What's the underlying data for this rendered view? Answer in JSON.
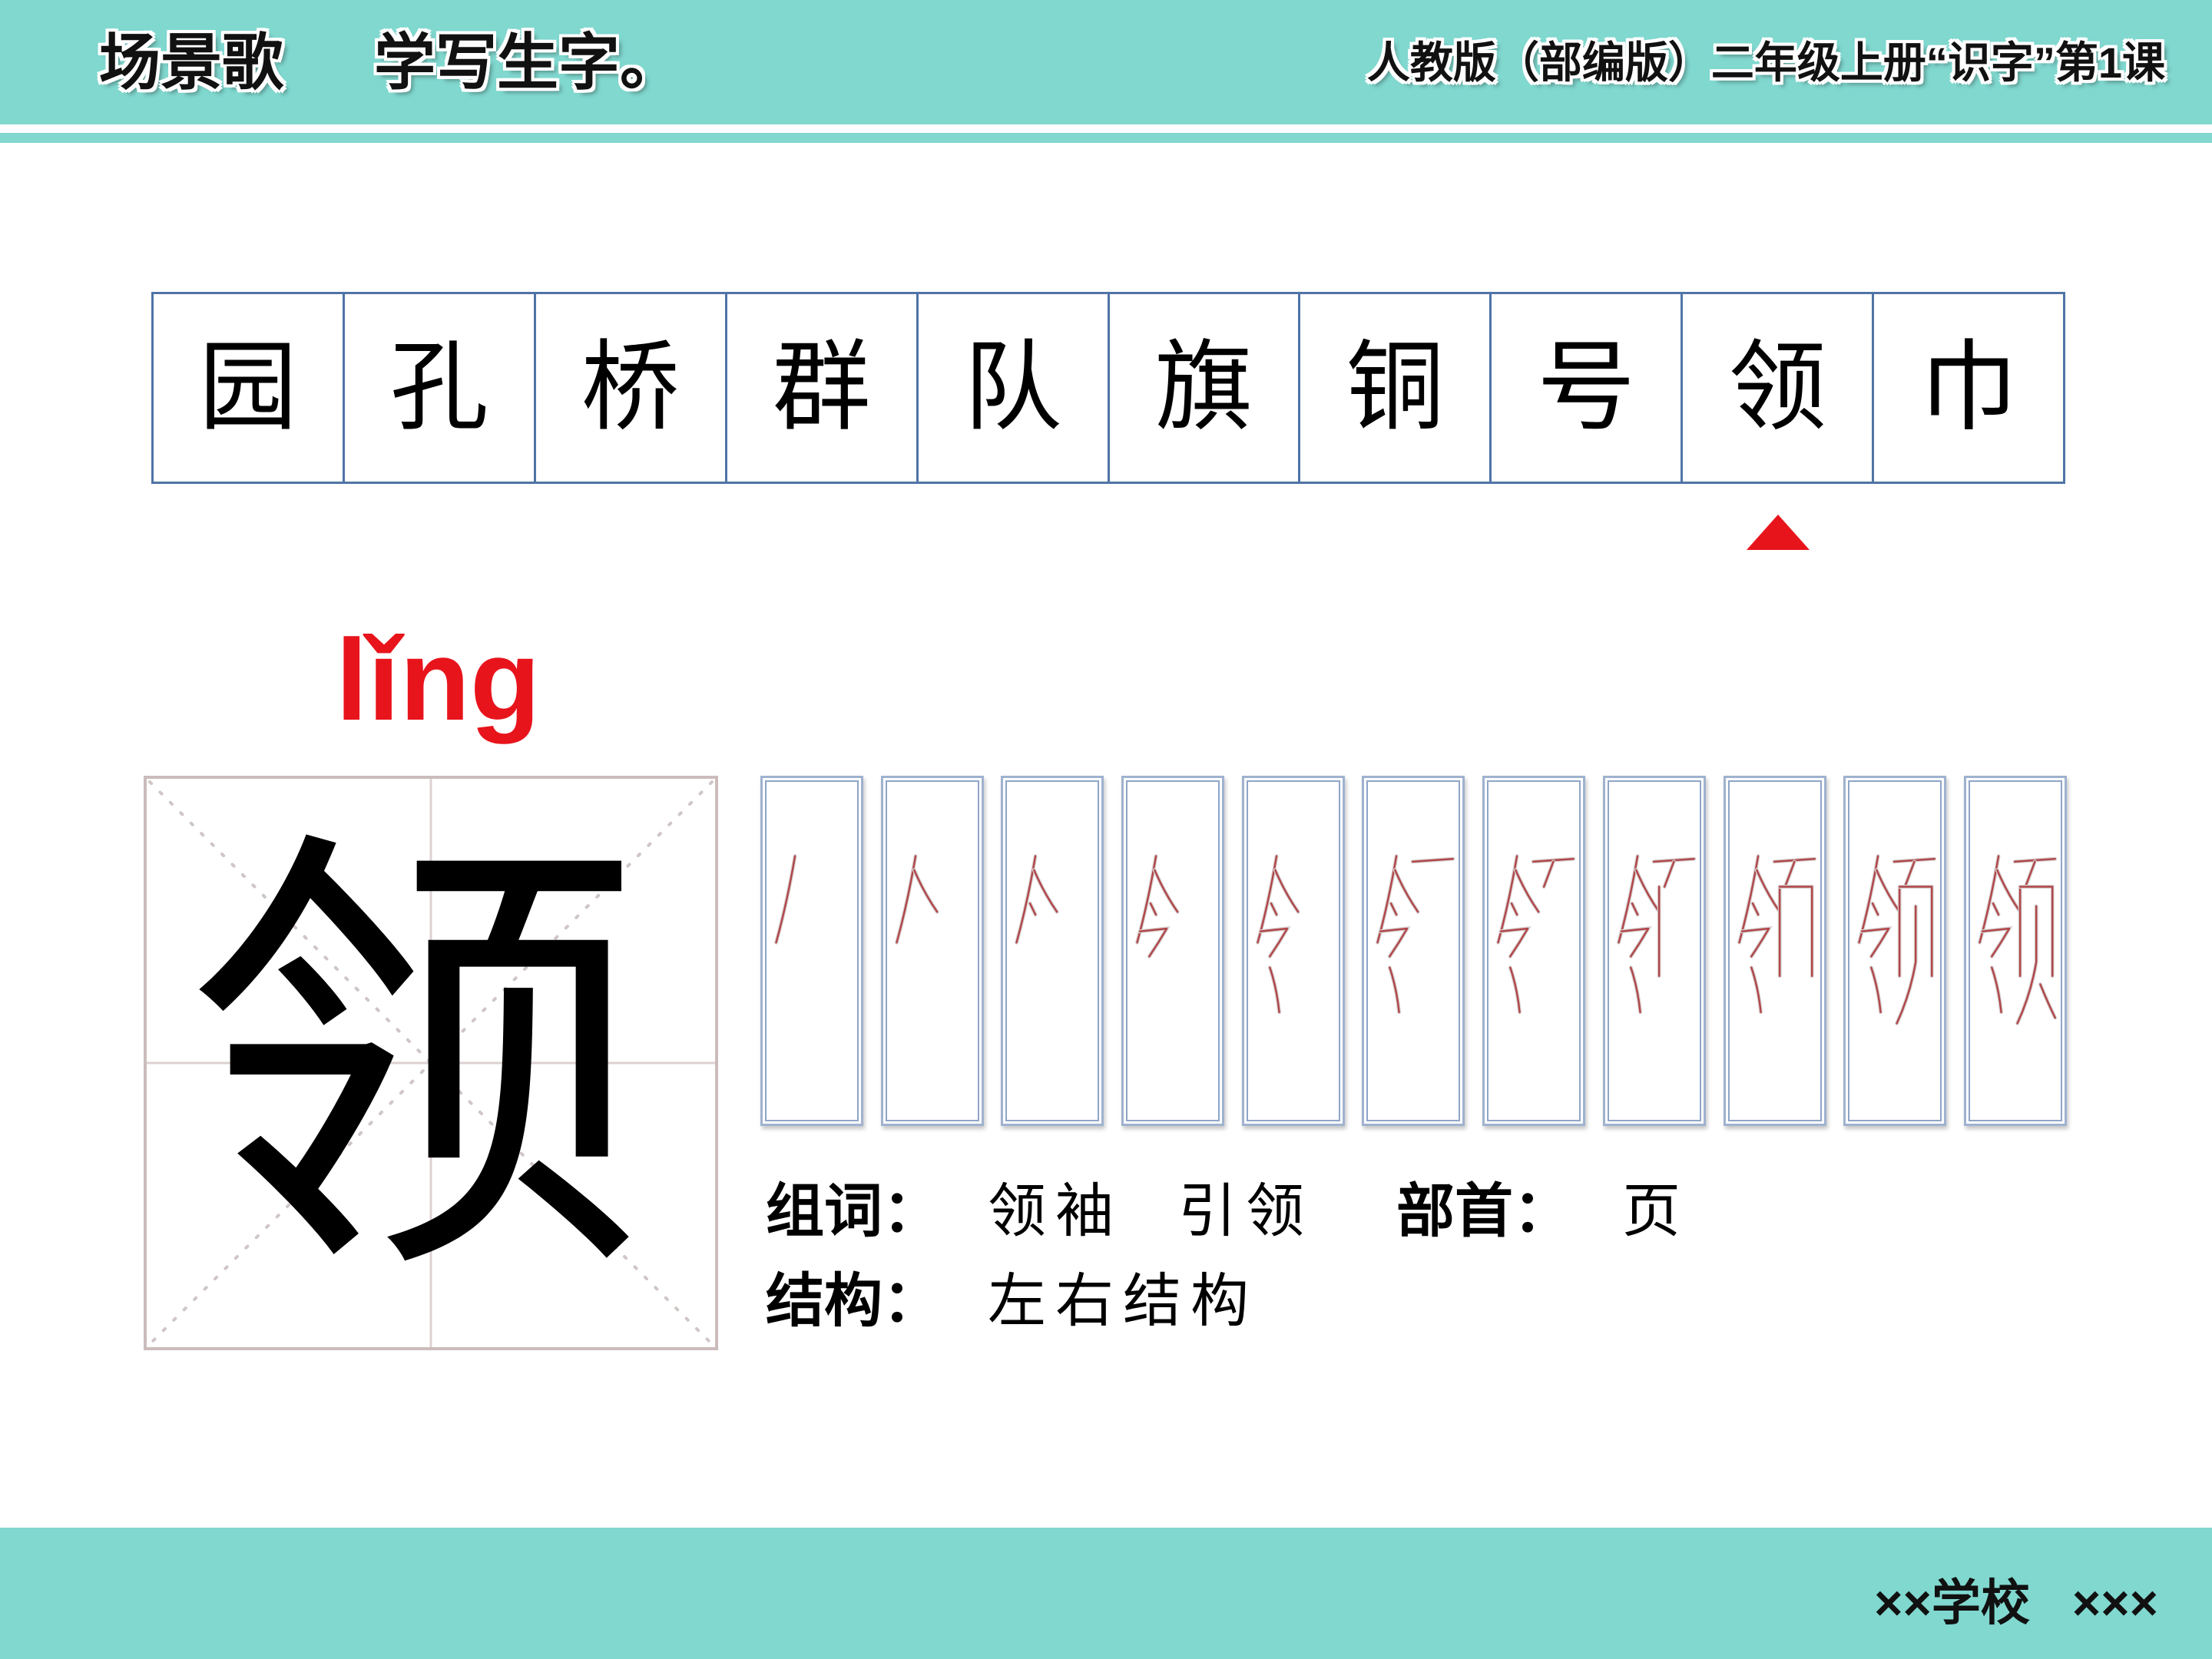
{
  "header": {
    "title": "场景歌",
    "subtitle": "学写生字。",
    "lesson": "人教版（部编版）二年级上册“识字”第1课"
  },
  "characters": [
    "园",
    "孔",
    "桥",
    "群",
    "队",
    "旗",
    "铜",
    "号",
    "领",
    "巾"
  ],
  "selected_index": 8,
  "marker_icon": "triangle-up-icon",
  "focus": {
    "pinyin": "lǐng",
    "character": "领"
  },
  "info": {
    "words_label": "组词：",
    "words": [
      "领袖",
      "引领"
    ],
    "radical_label": "部首：",
    "radical": "页",
    "structure_label": "结构：",
    "structure": "左右结构"
  },
  "footer": {
    "school": "××学校",
    "teacher": "×××"
  },
  "colors": {
    "theme": "#80d8cf",
    "accent_red": "#e8141c",
    "grid_border": "#4f74a6",
    "stroke_red": "#b0474a"
  }
}
